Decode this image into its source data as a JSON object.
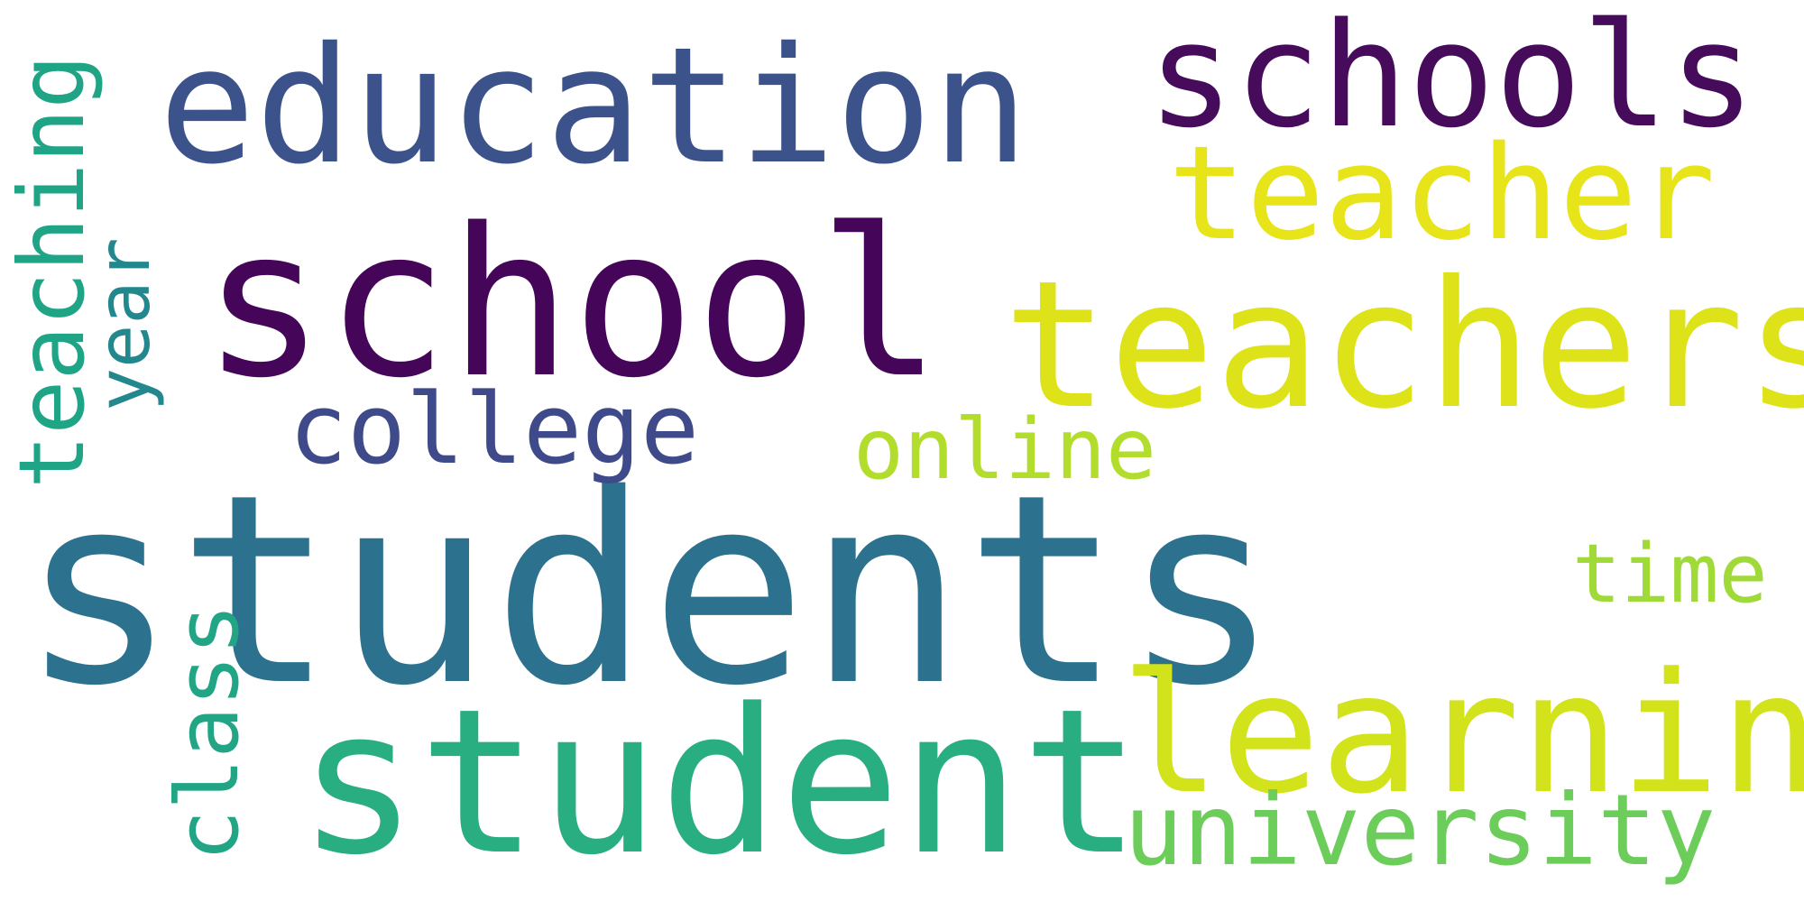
{
  "words": [
    {
      "id": "students",
      "text": "students",
      "color": "#2c728e"
    },
    {
      "id": "school",
      "text": "school",
      "color": "#450559"
    },
    {
      "id": "education",
      "text": "education",
      "color": "#3b528b"
    },
    {
      "id": "schools",
      "text": "schools",
      "color": "#470b5c"
    },
    {
      "id": "teacher",
      "text": "teacher",
      "color": "#e7e419"
    },
    {
      "id": "teachers",
      "text": "teachers",
      "color": "#dde318"
    },
    {
      "id": "college",
      "text": "college",
      "color": "#3e4a89"
    },
    {
      "id": "online",
      "text": "online",
      "color": "#b2dd2c"
    },
    {
      "id": "time",
      "text": "time",
      "color": "#a0da39"
    },
    {
      "id": "student",
      "text": "student",
      "color": "#28ae80"
    },
    {
      "id": "learning",
      "text": "learning",
      "color": "#d2e21b"
    },
    {
      "id": "university",
      "text": "university",
      "color": "#6ccd5a"
    },
    {
      "id": "teaching",
      "text": "teaching",
      "color": "#20a486"
    },
    {
      "id": "year",
      "text": "year",
      "color": "#23888e"
    },
    {
      "id": "class",
      "text": "class",
      "color": "#21a585"
    }
  ]
}
